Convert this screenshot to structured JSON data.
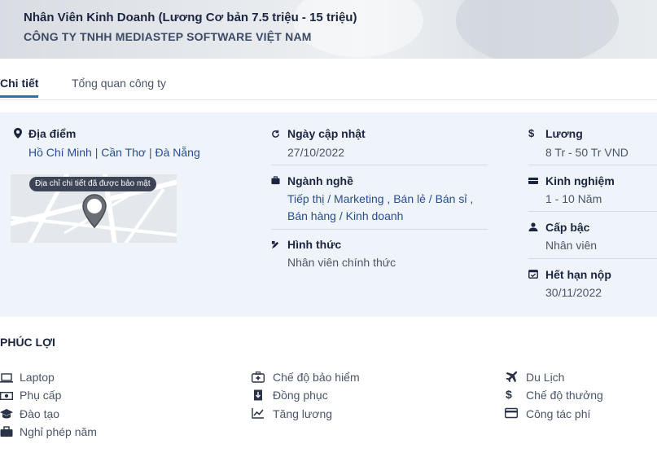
{
  "header": {
    "job_title": "Nhân Viên Kinh Doanh (Lương Cơ bản 7.5 triệu - 15 triệu)",
    "company": "CÔNG TY TNHH MEDIASTEP SOFTWARE VIỆT NAM"
  },
  "tabs": [
    {
      "label": "Chi tiết",
      "active": true
    },
    {
      "label": "Tổng quan công ty",
      "active": false
    }
  ],
  "info": {
    "location": {
      "label": "Địa điểm",
      "cities": [
        "Hồ Chí Minh",
        "Cần Thơ",
        "Đà Nẵng"
      ],
      "separator": " | ",
      "map_caption": "Địa chỉ chi tiết đã được bảo mật"
    },
    "updated": {
      "label": "Ngày cập nhật",
      "value": "27/10/2022"
    },
    "industry": {
      "label": "Ngành nghề",
      "line1": "Tiếp thị / Marketing , Bán lẻ / Bán sỉ ,",
      "line2": "Bán hàng / Kinh doanh"
    },
    "work_type": {
      "label": "Hình thức",
      "value": "Nhân viên chính thức"
    },
    "salary": {
      "label": "Lương",
      "value": "8 Tr - 50 Tr VND"
    },
    "experience": {
      "label": "Kinh nghiệm",
      "value": "1 - 10 Năm"
    },
    "level": {
      "label": "Cấp bậc",
      "value": "Nhân viên"
    },
    "deadline": {
      "label": "Hết hạn nộp",
      "value": "30/11/2022"
    }
  },
  "benefits": {
    "title": "PHÚC LỢI",
    "items": [
      {
        "label": "Laptop",
        "icon": "laptop-icon"
      },
      {
        "label": "Phụ cấp",
        "icon": "money-icon"
      },
      {
        "label": "Đào tạo",
        "icon": "graduation-cap-icon"
      },
      {
        "label": "Nghỉ phép năm",
        "icon": "briefcase-icon"
      },
      {
        "label": "Chế độ bảo hiểm",
        "icon": "medkit-icon"
      },
      {
        "label": "Đồng phục",
        "icon": "uniform-icon"
      },
      {
        "label": "Tăng lương",
        "icon": "chart-line-icon"
      },
      {
        "label": "Du Lịch",
        "icon": "plane-icon"
      },
      {
        "label": "Chế độ thưởng",
        "icon": "dollar-icon"
      },
      {
        "label": "Công tác phí",
        "icon": "credit-card-icon"
      }
    ]
  },
  "colors": {
    "accent": "#2f6db5",
    "info_bg": "#eef4f9",
    "link": "#2a4d8f",
    "text_dark": "#1c2540"
  }
}
